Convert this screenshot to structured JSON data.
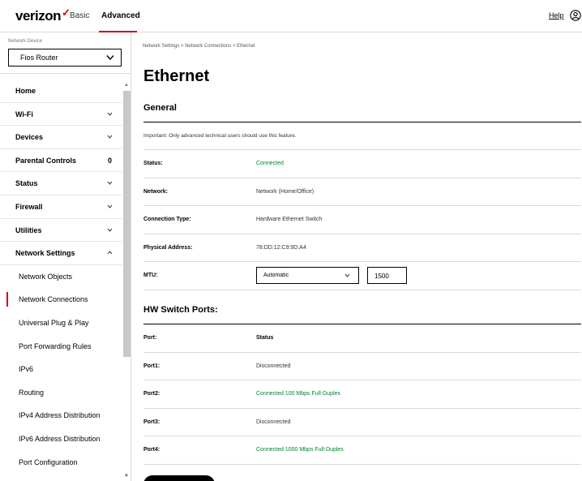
{
  "header": {
    "logo": "verizon",
    "logo_check": "✓",
    "tabs": [
      {
        "label": "Basic"
      },
      {
        "label": "Advanced"
      }
    ],
    "help_label": "Help",
    "accent_color": "#cd040b"
  },
  "sidebar": {
    "device_label": "Network Device",
    "device_value": "Fios Router",
    "items": [
      {
        "label": "Home"
      },
      {
        "label": "Wi-Fi"
      },
      {
        "label": "Devices"
      },
      {
        "label": "Parental Controls",
        "count": "0"
      },
      {
        "label": "Status"
      },
      {
        "label": "Firewall"
      },
      {
        "label": "Utilities"
      },
      {
        "label": "Network Settings"
      }
    ],
    "subitems": [
      {
        "label": "Network Objects"
      },
      {
        "label": "Network Connections"
      },
      {
        "label": "Universal Plug & Play"
      },
      {
        "label": "Port Forwarding Rules"
      },
      {
        "label": "IPv6"
      },
      {
        "label": "Routing"
      },
      {
        "label": "IPv4 Address Distribution"
      },
      {
        "label": "IPv6 Address Distribution"
      },
      {
        "label": "Port Configuration"
      }
    ]
  },
  "main": {
    "breadcrumb": "Network Settings  >  Network Connections  >  Ethernet",
    "title": "Ethernet",
    "general": {
      "title": "General",
      "notice": "Important: Only advanced technical users should use this feature.",
      "rows": [
        {
          "label": "Status:",
          "value": "Connected"
        },
        {
          "label": "Network:",
          "value": "Network (Home/Office)"
        },
        {
          "label": "Connection Type:",
          "value": "Hardware Ethernet Switch"
        },
        {
          "label": "Physical Address:",
          "value": "78:DD:12:C9:9D:A4"
        }
      ],
      "mtu_label": "MTU:",
      "mtu_mode": "Automatic",
      "mtu_value": "1500"
    },
    "switch_ports": {
      "title": "HW Switch Ports:",
      "col_port": "Port:",
      "col_status": "Status",
      "ports": [
        {
          "label": "Port1:",
          "status": "Disconnected"
        },
        {
          "label": "Port2:",
          "status": "Connected 100 Mbps Full-Duplex"
        },
        {
          "label": "Port3:",
          "status": "Disconnected"
        },
        {
          "label": "Port4:",
          "status": "Connected 1000 Mbps Full-Duplex"
        }
      ]
    },
    "connected_color": "#008331"
  }
}
